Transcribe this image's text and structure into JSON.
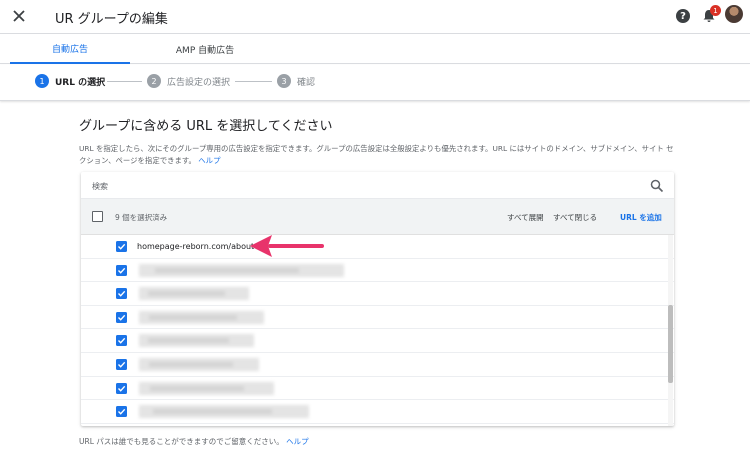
{
  "header": {
    "title": "UR グループの編集",
    "close_icon": "close-icon",
    "help_label": "?",
    "notification_count": "1",
    "colors": {
      "accent": "#1a73e8",
      "badge": "#d93025"
    }
  },
  "tabs": [
    {
      "label": "自動広告",
      "active": true
    },
    {
      "label": "AMP 自動広告",
      "active": false
    }
  ],
  "stepper": {
    "steps": [
      {
        "num": "1",
        "label": "URL の選択",
        "active": true
      },
      {
        "num": "2",
        "label": "広告設定の選択",
        "active": false
      },
      {
        "num": "3",
        "label": "確認",
        "active": false
      }
    ]
  },
  "main": {
    "heading": "グループに含める URL を選択してください",
    "description": "URL を指定したら、次にそのグループ専用の広告設定を指定できます。グループの広告設定は全般設定よりも優先されます。URL にはサイトのドメイン、サブドメイン、サイト セクション、ページを指定できます。",
    "help_link": "ヘルプ"
  },
  "url_list": {
    "search_label": "検索",
    "selected_count": "9 個を選択済み",
    "expand_all": "すべて展開",
    "collapse_all": "すべて閉じる",
    "add_url": "URL を追加",
    "rows": [
      {
        "text": "homepage-reborn.com/about",
        "checked": true
      },
      {
        "text": "",
        "checked": true,
        "redacted": true
      },
      {
        "text": "",
        "checked": true,
        "redacted": true
      },
      {
        "text": "",
        "checked": true,
        "redacted": true
      },
      {
        "text": "",
        "checked": true,
        "redacted": true
      },
      {
        "text": "",
        "checked": true,
        "redacted": true
      },
      {
        "text": "",
        "checked": true,
        "redacted": true
      },
      {
        "text": "",
        "checked": true,
        "redacted": true
      }
    ]
  },
  "footer": {
    "note": "URL パスは誰でも見ることができますのでご留意ください。",
    "help_link": "ヘルプ"
  },
  "annotation": {
    "arrow_color": "#e8336b"
  }
}
